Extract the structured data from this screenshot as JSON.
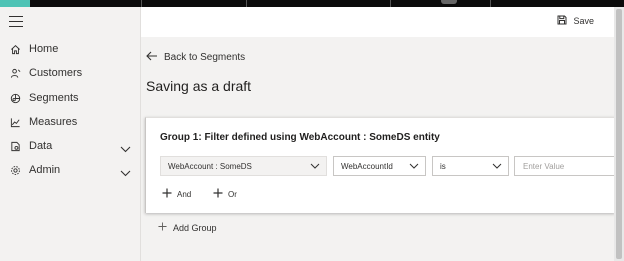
{
  "sidebar": {
    "items": [
      {
        "label": "Home",
        "icon": "home-icon"
      },
      {
        "label": "Customers",
        "icon": "customers-icon"
      },
      {
        "label": "Segments",
        "icon": "segments-icon"
      },
      {
        "label": "Measures",
        "icon": "measures-icon"
      },
      {
        "label": "Data",
        "icon": "data-icon",
        "expandable": true
      },
      {
        "label": "Admin",
        "icon": "gear-icon",
        "expandable": true
      }
    ]
  },
  "toolbar": {
    "save_label": "Save"
  },
  "main": {
    "back_label": "Back to Segments",
    "title": "Saving as a draft",
    "group": {
      "title": "Group 1: Filter defined using WebAccount : SomeDS entity",
      "entity_value": "WebAccount : SomeDS",
      "attribute_value": "WebAccountId",
      "operator_value": "is",
      "value_placeholder": "Enter Value",
      "and_label": "And",
      "or_label": "Or"
    },
    "add_group_label": "Add Group"
  },
  "colors": {
    "accent": "#4ec3b5",
    "topbar": "#0b0b0b",
    "background": "#f3f2f1"
  }
}
